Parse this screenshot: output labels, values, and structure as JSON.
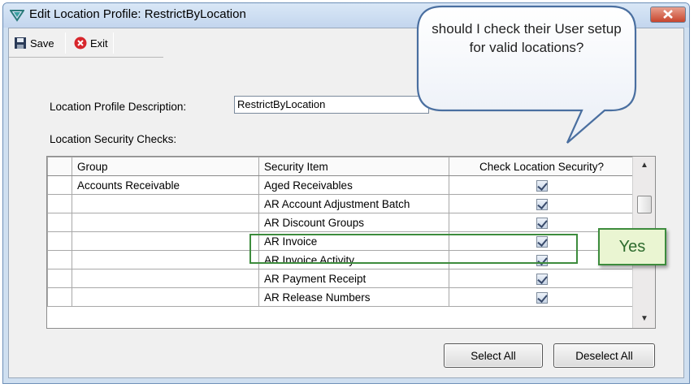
{
  "window": {
    "title": "Edit Location Profile: RestrictByLocation"
  },
  "toolbar": {
    "save_label": "Save",
    "exit_label": "Exit"
  },
  "form": {
    "description_label": "Location Profile Description:",
    "description_value": "RestrictByLocation",
    "checks_label": "Location Security Checks:"
  },
  "grid": {
    "columns": [
      "Group",
      "Security Item",
      "Check Location Security?"
    ],
    "rows": [
      {
        "group": "Accounts Receivable",
        "item": "Aged Receivables",
        "checked": true
      },
      {
        "group": "",
        "item": "AR Account Adjustment Batch",
        "checked": true
      },
      {
        "group": "",
        "item": "AR Discount Groups",
        "checked": true
      },
      {
        "group": "",
        "item": "AR Invoice",
        "checked": true
      },
      {
        "group": "",
        "item": "AR Invoice Activity",
        "checked": true
      },
      {
        "group": "",
        "item": "AR Payment Receipt",
        "checked": true
      },
      {
        "group": "",
        "item": "AR Release Numbers",
        "checked": true
      }
    ]
  },
  "buttons": {
    "select_all": "Select All",
    "deselect_all": "Deselect All"
  },
  "annotations": {
    "bubble_text": "should I check their User setup for valid locations?",
    "yes_text": "Yes"
  },
  "colors": {
    "highlight": "#3d8c3d",
    "titlebar": "#c3d6ee",
    "close_button": "#c8452d"
  },
  "icons": [
    "app-icon",
    "save-icon",
    "exit-icon",
    "minimize-icon",
    "maximize-icon",
    "close-icon",
    "checkbox-icon"
  ]
}
